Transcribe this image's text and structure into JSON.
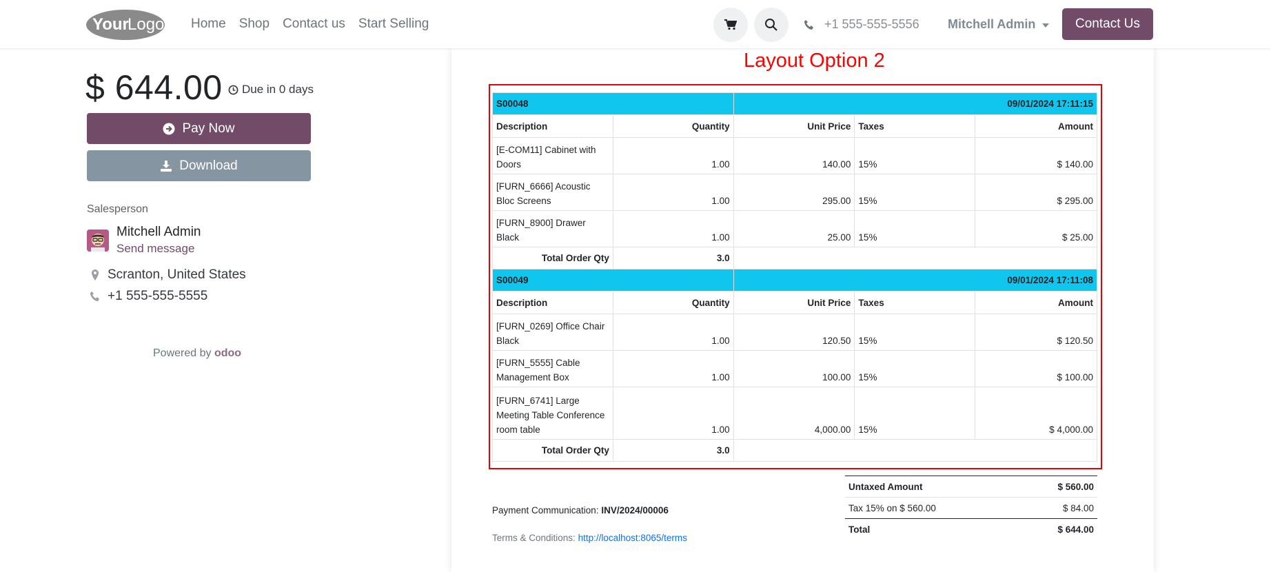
{
  "header": {
    "logo_text": "YourLogo",
    "nav": [
      "Home",
      "Shop",
      "Contact us",
      "Start Selling"
    ],
    "phone": "+1 555-555-5556",
    "user": "Mitchell Admin",
    "contact_button": "Contact Us"
  },
  "sidebar": {
    "amount": "$ 644.00",
    "due": "Due in 0 days",
    "pay_button": "Pay Now",
    "download_button": "Download",
    "salesperson_label": "Salesperson",
    "salesperson_name": "Mitchell Admin",
    "send_message": "Send message",
    "location": "Scranton, United States",
    "phone": "+1 555-555-5555",
    "powered_by": "Powered by",
    "powered_brand": "odoo"
  },
  "document": {
    "layout_title": "Layout Option 2",
    "columns": {
      "description": "Description",
      "quantity": "Quantity",
      "unit_price": "Unit Price",
      "taxes": "Taxes",
      "amount": "Amount"
    },
    "total_qty_label": "Total Order Qty",
    "orders": [
      {
        "ref": "S00048",
        "date": "09/01/2024 17:11:15",
        "lines": [
          {
            "desc": "[E-COM11] Cabinet with Doors",
            "qty": "1.00",
            "unit": "140.00",
            "tax": "15%",
            "amount": "$ 140.00"
          },
          {
            "desc": "[FURN_6666] Acoustic Bloc Screens",
            "qty": "1.00",
            "unit": "295.00",
            "tax": "15%",
            "amount": "$ 295.00"
          },
          {
            "desc": "[FURN_8900] Drawer Black",
            "qty": "1.00",
            "unit": "25.00",
            "tax": "15%",
            "amount": "$ 25.00"
          }
        ],
        "total_qty": "3.0"
      },
      {
        "ref": "S00049",
        "date": "09/01/2024 17:11:08",
        "lines": [
          {
            "desc": "[FURN_0269] Office Chair Black",
            "qty": "1.00",
            "unit": "120.50",
            "tax": "15%",
            "amount": "$ 120.50"
          },
          {
            "desc": "[FURN_5555] Cable Management Box",
            "qty": "1.00",
            "unit": "100.00",
            "tax": "15%",
            "amount": "$ 100.00"
          },
          {
            "desc": "[FURN_6741] Large Meeting Table Conference room table",
            "qty": "1.00",
            "unit": "4,000.00",
            "tax": "15%",
            "amount": "$ 4,000.00"
          }
        ],
        "total_qty": "3.0"
      }
    ],
    "totals": {
      "untaxed_label": "Untaxed Amount",
      "untaxed_value": "$ 560.00",
      "tax_label": "Tax 15% on $ 560.00",
      "tax_value": "$ 84.00",
      "total_label": "Total",
      "total_value": "$ 644.00"
    },
    "payment_comm_label": "Payment Communication:",
    "payment_comm_value": "INV/2024/00006",
    "terms_label": "Terms & Conditions:",
    "terms_link": "http://localhost:8065/terms"
  },
  "colors": {
    "brand": "#714b67",
    "secondary_button": "#8595a2",
    "order_header": "#0fc7ee",
    "layout_box": "#e60000"
  }
}
